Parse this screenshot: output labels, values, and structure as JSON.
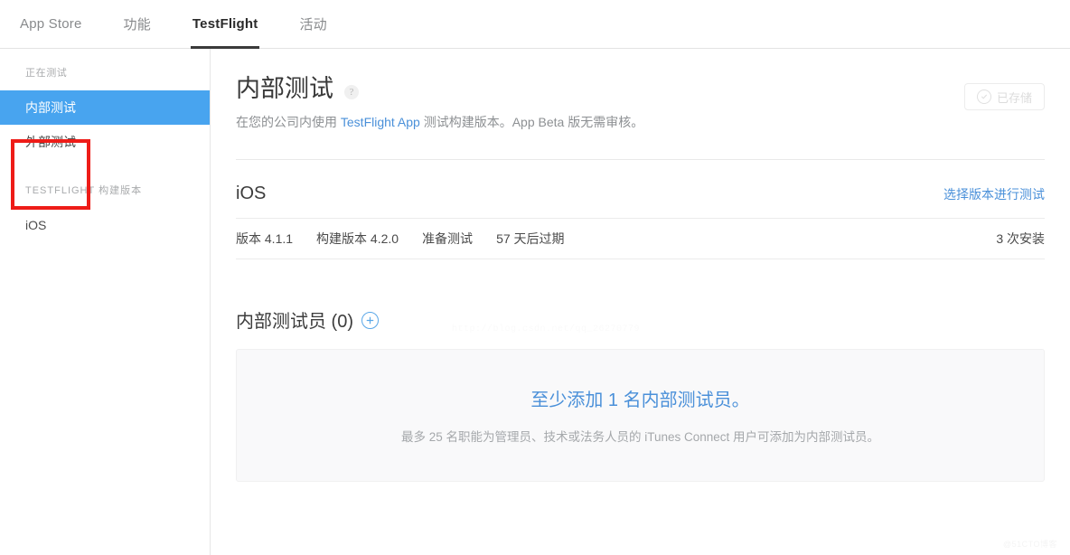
{
  "topnav": {
    "tabs": [
      {
        "label": "App Store",
        "active": false
      },
      {
        "label": "功能",
        "active": false
      },
      {
        "label": "TestFlight",
        "active": true
      },
      {
        "label": "活动",
        "active": false
      }
    ]
  },
  "sidebar": {
    "group_testing_title": "正在测试",
    "items": [
      {
        "label": "内部测试",
        "selected": true
      },
      {
        "label": "外部测试",
        "selected": false
      }
    ],
    "group_builds_title": "TESTFLIGHT 构建版本",
    "build_items": [
      {
        "label": "iOS",
        "selected": false
      }
    ]
  },
  "page": {
    "title": "内部测试",
    "help_icon": "question-mark-icon",
    "subtitle_before": "在您的公司内使用 ",
    "subtitle_link": "TestFlight App",
    "subtitle_after": " 测试构建版本。App Beta 版无需审核。",
    "saved_button": "已存储",
    "saved_icon": "check-circle-icon"
  },
  "ios_section": {
    "title": "iOS",
    "select_build_link": "选择版本进行测试",
    "build": {
      "version": "版本 4.1.1",
      "build_number": "构建版本 4.2.0",
      "status": "准备测试",
      "expiry": "57 天后过期",
      "installs": "3 次安装"
    }
  },
  "testers_section": {
    "title": "内部测试员 (0)",
    "add_icon": "plus-circle-icon",
    "empty_title": "至少添加 1 名内部测试员。",
    "empty_subtitle": "最多 25 名职能为管理员、技术或法务人员的 iTunes Connect 用户可添加为内部测试员。"
  },
  "watermarks": {
    "center": "http://blog.csdn.net/qq_26270779",
    "corner": "@51CTO博客"
  },
  "colors": {
    "accent_blue": "#4a90d9",
    "selected_blue": "#48a4ef",
    "annotation_red": "#ee1c18",
    "muted_text": "#8d9093"
  }
}
